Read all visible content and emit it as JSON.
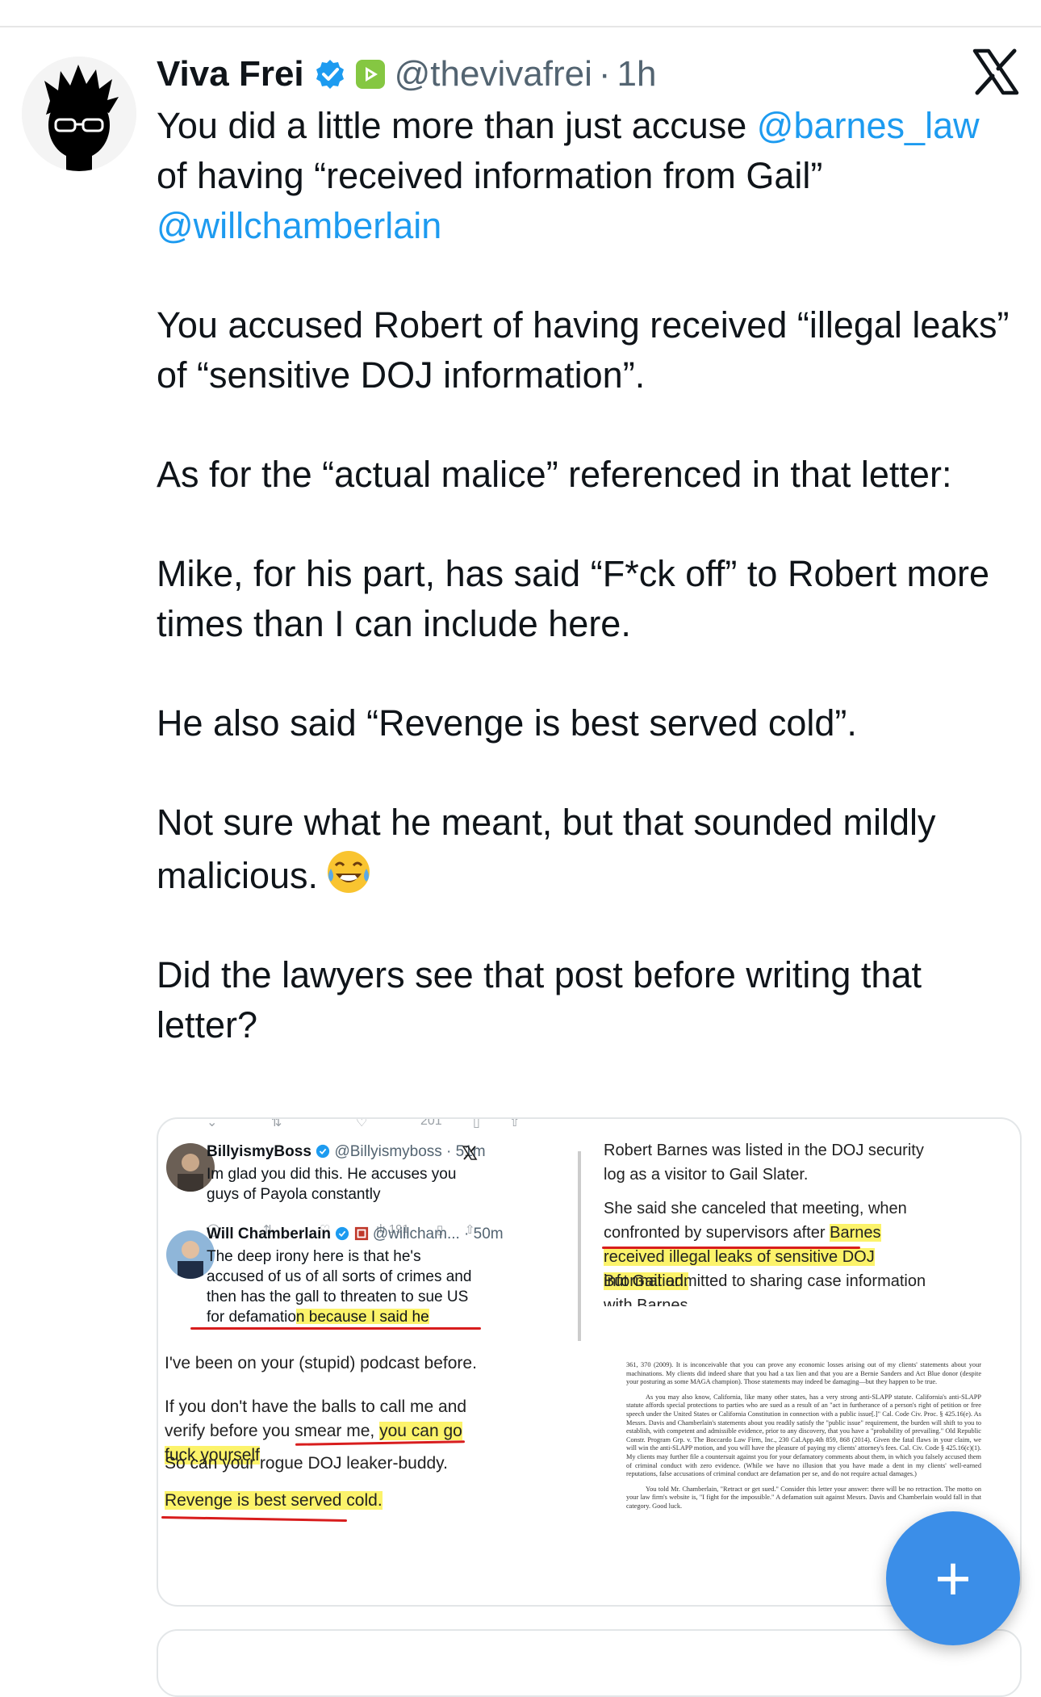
{
  "post": {
    "name": "Viva Frei",
    "handle": "@thevivafrei",
    "separator": "·",
    "time": "1h",
    "paragraphs": {
      "p1": {
        "a": "You did a little more than just accuse ",
        "m1": "@barnes_law",
        "b": " of having “received information from Gail” ",
        "m2": "@willchamberlain"
      },
      "p2": "You accused Robert of having received “illegal leaks” of “sensitive DOJ information”.",
      "p3": "As for the “actual malice” referenced in that letter:",
      "p4": "Mike, for his part, has said “F*ck off” to Robert more times than I can include here.",
      "p5": "He also said “Revenge is best served cold”.",
      "p6": "Not sure what he meant, but that sounded mildly malicious.",
      "p7": "Did the lawyers see that post before writing that letter?"
    },
    "emoji": "face-with-tears-of-joy"
  },
  "media": {
    "left": {
      "faded_count": "201",
      "tweet1": {
        "name": "BillyismyBoss",
        "handle": "@Billyismyboss · 51m",
        "text": "Im glad you did this. He accuses you guys of Payola constantly",
        "views": "191"
      },
      "tweet2": {
        "name": "Will Chamberlain",
        "handle": "@willcham... · 50m",
        "text_a": "The deep irony here is that he's accused of us of all sorts of crimes and then has the gall to threaten to sue US for defamatio",
        "text_hl": "n because I said he received information from Gail Slater"
      },
      "msg1": "I've been on your (stupid) podcast before.",
      "msg2_a": "If you don't have the balls to call me and verify before you smear me, ",
      "msg2_hl": "you can go fuck yourself",
      "msg3": "So can your rogue DOJ leaker-buddy.",
      "msg4": "Revenge is best served cold."
    },
    "right": {
      "para1": "Robert Barnes was listed in the DOJ security log as a visitor to Gail Slater.",
      "para2_a": "She said she canceled that meeting, when confronted by supervisors after ",
      "para2_hl": "Barnes received illegal leaks of sensitive DOJ information.",
      "para3": "But Gail admitted to sharing case information with Barnes.",
      "legal1": "361, 370 (2009). It is inconceivable that you can prove any economic losses arising out of my clients' statements about your machinations. My clients did indeed share that you had a tax lien and that you are a Bernie Sanders and Act Blue donor (despite your posturing as some MAGA champion). Those statements may indeed be damaging—but they happen to be true.",
      "legal2": "As you may also know, California, like many other states, has a very strong anti-SLAPP statute. California's anti-SLAPP statute affords special protections to parties who are sued as a result of an \"act in furtherance of a person's right of petition or free speech under the United States or California Constitution in connection with a public issue[.]\" Cal. Code Civ. Proc. § 425.16(e). As Messrs. Davis and Chamberlain's statements about you readily satisfy the \"public issue\" requirement, the burden will shift to you to establish, with competent and admissible evidence, prior to any discovery, that you have a \"probability of prevailing.\" Old Republic Constr. Program Grp. v. The Boccardo Law Firm, Inc., 230 Cal.App.4th 859, 868 (2014). Given the fatal flaws in your claim, we will win the anti-SLAPP motion, and you will have the pleasure of paying my clients' attorney's fees. Cal. Civ. Code § 425.16(c)(1). My clients may further file a countersuit against you for your defamatory comments about them, in which you falsely accused them of criminal conduct with zero evidence. (While we have no illusion that you have made a dent in my clients' well-earned reputations, false accusations of criminal conduct are defamation per se, and do not require actual damages.)",
      "legal3": "You told Mr. Chamberlain, \"Retract or get sued.\" Consider this letter your answer: there will be no retraction. The motto on your law firm's website is, \"I fight for the impossible.\" A defamation suit against Messrs. Davis and Chamberlain would fall in that category. Good luck."
    }
  },
  "fab": {
    "label": "+"
  }
}
